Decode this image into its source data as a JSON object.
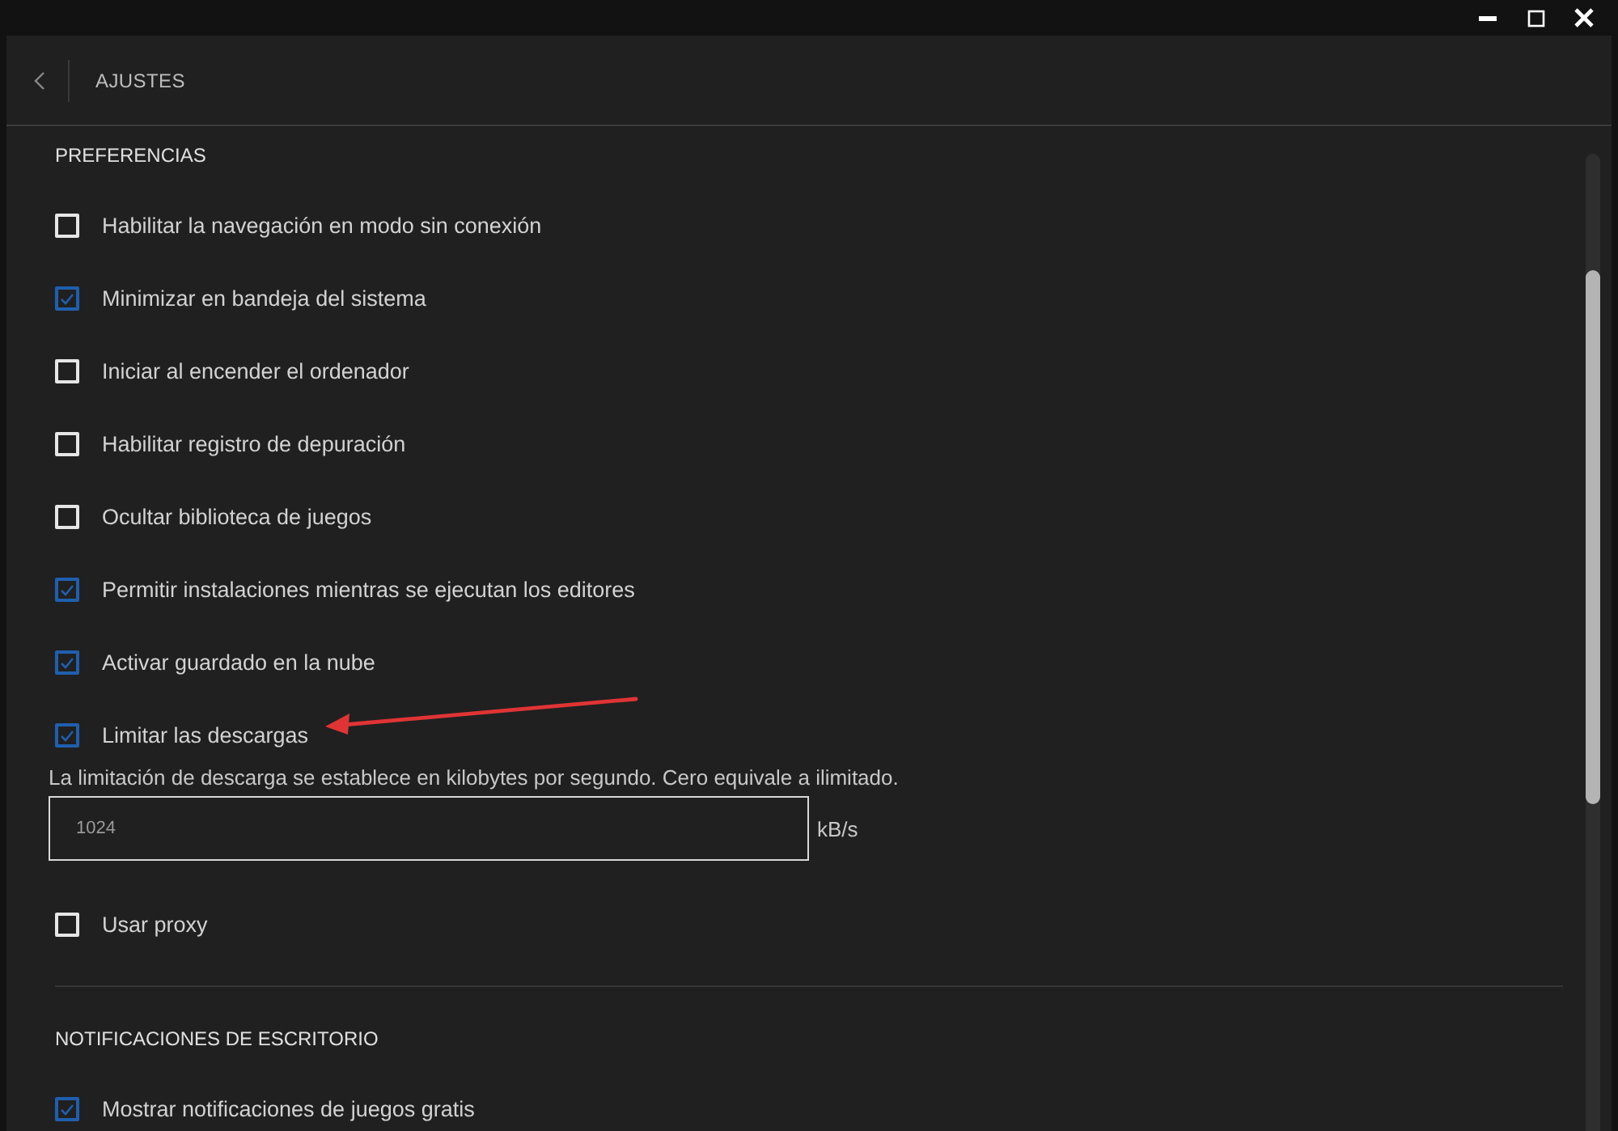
{
  "header": {
    "title": "AJUSTES"
  },
  "sections": [
    {
      "title": "PREFERENCIAS",
      "items": [
        {
          "kind": "checkbox",
          "label": "Habilitar la navegación en modo sin conexión",
          "checked": false
        },
        {
          "kind": "checkbox",
          "label": "Minimizar en bandeja del sistema",
          "checked": true
        },
        {
          "kind": "checkbox",
          "label": "Iniciar al encender el ordenador",
          "checked": false
        },
        {
          "kind": "checkbox",
          "label": "Habilitar registro de depuración",
          "checked": false
        },
        {
          "kind": "checkbox",
          "label": "Ocultar biblioteca de juegos",
          "checked": false
        },
        {
          "kind": "checkbox",
          "label": "Permitir instalaciones mientras se ejecutan los editores",
          "checked": true
        },
        {
          "kind": "checkbox",
          "label": "Activar guardado en la nube",
          "checked": true
        },
        {
          "kind": "limit",
          "label": "Limitar las descargas",
          "checked": true,
          "hint": "La limitación de descarga se establece en kilobytes por segundo. Cero equivale a ilimitado.",
          "value": "1024",
          "unit": "kB/s"
        },
        {
          "kind": "checkbox",
          "label": "Usar proxy",
          "checked": false
        }
      ]
    },
    {
      "title": "NOTIFICACIONES DE ESCRITORIO",
      "items": [
        {
          "kind": "checkbox",
          "label": "Mostrar notificaciones de juegos gratis",
          "checked": true
        }
      ]
    }
  ]
}
